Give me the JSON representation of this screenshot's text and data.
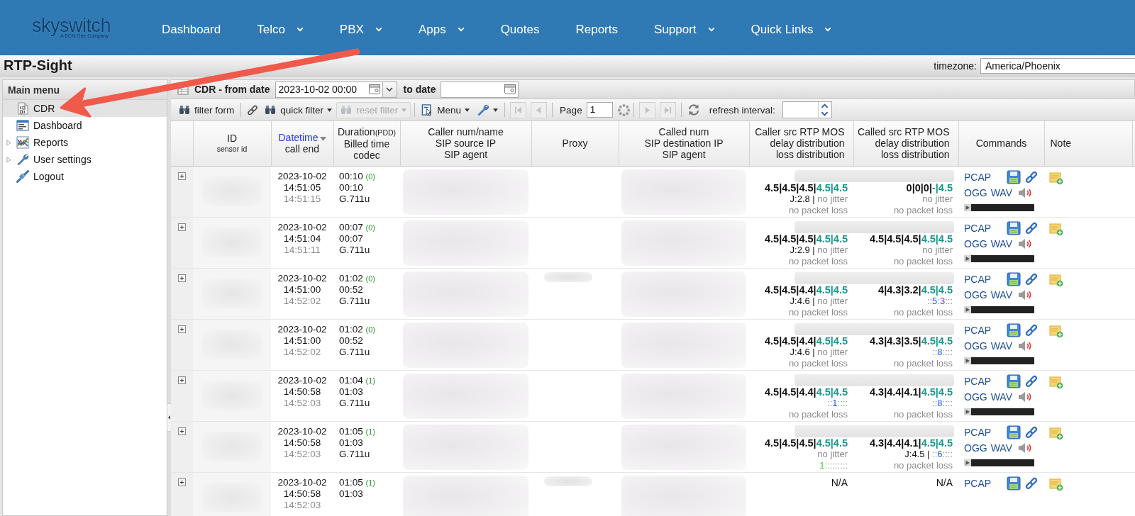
{
  "nav": {
    "logo": "skyswitch",
    "tagline": "A BCN One Company",
    "items": [
      {
        "label": "Dashboard",
        "dropdown": false
      },
      {
        "label": "Telco",
        "dropdown": true
      },
      {
        "label": "PBX",
        "dropdown": true
      },
      {
        "label": "Apps",
        "dropdown": true
      },
      {
        "label": "Quotes",
        "dropdown": false
      },
      {
        "label": "Reports",
        "dropdown": false
      },
      {
        "label": "Support",
        "dropdown": true
      },
      {
        "label": "Quick Links",
        "dropdown": true
      }
    ]
  },
  "title_bar": {
    "title": "RTP-Sight",
    "timezone_label": "timezone:",
    "timezone": "America/Phoenix"
  },
  "sidebar": {
    "title": "Main menu",
    "items": [
      {
        "label": "CDR",
        "kind": "leaf",
        "selected": true
      },
      {
        "label": "Dashboard",
        "kind": "leaf",
        "selected": false
      },
      {
        "label": "Reports",
        "kind": "folder",
        "expanded": false,
        "selected": false
      },
      {
        "label": "User settings",
        "kind": "folder",
        "expanded": false,
        "selected": false
      },
      {
        "label": "Logout",
        "kind": "leaf",
        "selected": false
      }
    ]
  },
  "filter_bar": {
    "title": "CDR - from date",
    "from_date": "2023-10-02 00:00",
    "to_label": "to date"
  },
  "toolbar": {
    "filter_form": "filter form",
    "quick_filter": {
      "label": "quick filter",
      "disabled": false
    },
    "reset_filter": {
      "label": "reset filter",
      "disabled": true
    },
    "menu": "Menu",
    "pager": [
      {
        "disabled": true
      },
      {
        "disabled": true
      },
      {
        "disabled": true
      },
      {
        "disabled": true
      }
    ],
    "page_label": "Page",
    "page": "1",
    "refresh_label": "refresh interval:"
  },
  "table": {
    "columns": [
      {
        "lines": [
          "ID"
        ],
        "sub": "sensor id",
        "sorted": false
      },
      {
        "lines": [
          "Datetime",
          "call end"
        ],
        "sorted": true
      },
      {
        "lines": [
          "Duration",
          "Billed time",
          "codec"
        ],
        "suffix": "(PDD)",
        "sorted": false
      },
      {
        "lines": [
          "Caller num/name",
          "SIP source IP",
          "SIP agent"
        ],
        "sorted": false
      },
      {
        "lines": [
          "Proxy"
        ],
        "sorted": false
      },
      {
        "lines": [
          "Called num",
          "SIP destination IP",
          "SIP agent"
        ],
        "sorted": false
      },
      {
        "lines": [
          "Caller src RTP MOS",
          "delay distribution",
          "loss distribution"
        ],
        "sorted": false
      },
      {
        "lines": [
          "Called src RTP MOS",
          "delay distribution",
          "loss distribution"
        ],
        "sorted": false
      },
      {
        "lines": [
          "Commands"
        ],
        "sorted": false
      },
      {
        "lines": [
          "Note"
        ],
        "sorted": false
      }
    ],
    "rows": [
      {
        "datetime": {
          "date": "2023-10-02",
          "start": "14:51:05",
          "end": "14:51:15"
        },
        "duration": {
          "total": "00:10",
          "pdd": "(0)",
          "billed": "00:10",
          "codec": "G.711u"
        },
        "proxy_redacted": false,
        "caller_rtp": {
          "mos": [
            {
              "text": "4.5|4.5|4.5|",
              "kind": "value"
            },
            {
              "text": "4.5|4.5",
              "kind": "estimate"
            }
          ],
          "jitter": [
            {
              "text": "J:2.8 | ",
              "kind": "value"
            },
            {
              "text": "no jitter",
              "kind": "muted"
            }
          ],
          "loss": [
            {
              "text": "no packet loss",
              "kind": "muted"
            }
          ]
        },
        "called_rtp": {
          "mos": [
            {
              "text": "0|0|0|",
              "kind": "value"
            },
            {
              "text": "-|4.5",
              "kind": "estimate"
            }
          ],
          "jitter": [
            {
              "text": "no jitter",
              "kind": "muted"
            }
          ],
          "loss": [
            {
              "text": "no packet loss",
              "kind": "muted"
            }
          ]
        },
        "commands": {
          "pcap": "PCAP",
          "ogg": "OGG",
          "wav": "WAV"
        }
      },
      {
        "datetime": {
          "date": "2023-10-02",
          "start": "14:51:04",
          "end": "14:51:11"
        },
        "duration": {
          "total": "00:07",
          "pdd": "(0)",
          "billed": "00:07",
          "codec": "G.711u"
        },
        "proxy_redacted": false,
        "caller_rtp": {
          "mos": [
            {
              "text": "4.5|4.5|4.5|",
              "kind": "value"
            },
            {
              "text": "4.5|4.5",
              "kind": "estimate"
            }
          ],
          "jitter": [
            {
              "text": "J:2.9 | ",
              "kind": "value"
            },
            {
              "text": "no jitter",
              "kind": "muted"
            }
          ],
          "loss": [
            {
              "text": "no packet loss",
              "kind": "muted"
            }
          ]
        },
        "called_rtp": {
          "mos": [
            {
              "text": "4.5|4.5|4.5|",
              "kind": "value"
            },
            {
              "text": "4.5|4.5",
              "kind": "estimate"
            }
          ],
          "jitter": [
            {
              "text": "no jitter",
              "kind": "muted"
            }
          ],
          "loss": [
            {
              "text": "no packet loss",
              "kind": "muted"
            }
          ]
        },
        "commands": {
          "pcap": "PCAP",
          "ogg": "OGG",
          "wav": "WAV"
        }
      },
      {
        "datetime": {
          "date": "2023-10-02",
          "start": "14:51:00",
          "end": "14:52:02"
        },
        "duration": {
          "total": "01:02",
          "pdd": "(0)",
          "billed": "00:52",
          "codec": "G.711u"
        },
        "proxy_redacted": true,
        "caller_rtp": {
          "mos": [
            {
              "text": "4.5|4.5|4.4|",
              "kind": "value"
            },
            {
              "text": "4.5|4.5",
              "kind": "estimate"
            }
          ],
          "jitter": [
            {
              "text": "J:4.6 | ",
              "kind": "value"
            },
            {
              "text": "no jitter",
              "kind": "muted"
            }
          ],
          "loss": [
            {
              "text": "no packet loss",
              "kind": "muted"
            }
          ]
        },
        "called_rtp": {
          "mos": [
            {
              "text": "4|4.3|3.2|",
              "kind": "value"
            },
            {
              "text": "4.5|4.5",
              "kind": "estimate"
            }
          ],
          "jitter": [
            {
              "text": "::",
              "kind": "muted"
            },
            {
              "text": "5",
              "kind": "bucket"
            },
            {
              "text": ":",
              "kind": "muted"
            },
            {
              "text": "3",
              "kind": "peak"
            },
            {
              "text": ":::",
              "kind": "muted"
            }
          ],
          "loss": [
            {
              "text": "no packet loss",
              "kind": "muted"
            }
          ]
        },
        "commands": {
          "pcap": "PCAP",
          "ogg": "OGG",
          "wav": "WAV"
        }
      },
      {
        "datetime": {
          "date": "2023-10-02",
          "start": "14:51:00",
          "end": "14:52:02"
        },
        "duration": {
          "total": "01:02",
          "pdd": "(0)",
          "billed": "00:52",
          "codec": "G.711u"
        },
        "proxy_redacted": false,
        "caller_rtp": {
          "mos": [
            {
              "text": "4.5|4.5|4.4|",
              "kind": "value"
            },
            {
              "text": "4.5|4.5",
              "kind": "estimate"
            }
          ],
          "jitter": [
            {
              "text": "J:4.6 | ",
              "kind": "value"
            },
            {
              "text": "no jitter",
              "kind": "muted"
            }
          ],
          "loss": [
            {
              "text": "no packet loss",
              "kind": "muted"
            }
          ]
        },
        "called_rtp": {
          "mos": [
            {
              "text": "4.3|4.3|3.5|",
              "kind": "value"
            },
            {
              "text": "4.5|4.5",
              "kind": "estimate"
            }
          ],
          "jitter": [
            {
              "text": "::",
              "kind": "muted"
            },
            {
              "text": "8",
              "kind": "bucket"
            },
            {
              "text": "::::",
              "kind": "muted"
            }
          ],
          "loss": [
            {
              "text": "no packet loss",
              "kind": "muted"
            }
          ]
        },
        "commands": {
          "pcap": "PCAP",
          "ogg": "OGG",
          "wav": "WAV"
        }
      },
      {
        "datetime": {
          "date": "2023-10-02",
          "start": "14:50:58",
          "end": "14:52:03"
        },
        "duration": {
          "total": "01:04",
          "pdd": "(1)",
          "billed": "01:03",
          "codec": "G.711u"
        },
        "proxy_redacted": false,
        "caller_rtp": {
          "mos": [
            {
              "text": "4.5|4.5|4.4|",
              "kind": "value"
            },
            {
              "text": "4.5|4.5",
              "kind": "estimate"
            }
          ],
          "jitter": [
            {
              "text": "::",
              "kind": "muted"
            },
            {
              "text": "1",
              "kind": "bucket"
            },
            {
              "text": "::::",
              "kind": "muted"
            }
          ],
          "loss": [
            {
              "text": "no packet loss",
              "kind": "muted"
            }
          ]
        },
        "called_rtp": {
          "mos": [
            {
              "text": "4.3|4.4|4.1|",
              "kind": "value"
            },
            {
              "text": "4.5|4.5",
              "kind": "estimate"
            }
          ],
          "jitter": [
            {
              "text": "::",
              "kind": "muted"
            },
            {
              "text": "8",
              "kind": "bucket"
            },
            {
              "text": "::::",
              "kind": "muted"
            }
          ],
          "loss": [
            {
              "text": "no packet loss",
              "kind": "muted"
            }
          ]
        },
        "commands": {
          "pcap": "PCAP",
          "ogg": "OGG",
          "wav": "WAV"
        }
      },
      {
        "datetime": {
          "date": "2023-10-02",
          "start": "14:50:58",
          "end": "14:52:03"
        },
        "duration": {
          "total": "01:05",
          "pdd": "(1)",
          "billed": "01:03",
          "codec": "G.711u"
        },
        "proxy_redacted": false,
        "caller_rtp": {
          "mos": [
            {
              "text": "4.5|4.5|4.5|",
              "kind": "value"
            },
            {
              "text": "4.5|4.5",
              "kind": "estimate"
            }
          ],
          "jitter": [
            {
              "text": "no jitter",
              "kind": "muted"
            }
          ],
          "loss": [
            {
              "text": "1",
              "kind": "loss"
            },
            {
              "text": ":::::::::",
              "kind": "muted"
            }
          ]
        },
        "called_rtp": {
          "mos": [
            {
              "text": "4.3|4.4|4.1|",
              "kind": "value"
            },
            {
              "text": "4.5|4.5",
              "kind": "estimate"
            }
          ],
          "jitter": [
            {
              "text": "J:4.5 | ",
              "kind": "value"
            },
            {
              "text": "::",
              "kind": "muted"
            },
            {
              "text": "6",
              "kind": "bucket"
            },
            {
              "text": "::::",
              "kind": "muted"
            }
          ],
          "loss": [
            {
              "text": "no packet loss",
              "kind": "muted"
            }
          ]
        },
        "commands": {
          "pcap": "PCAP",
          "ogg": "OGG",
          "wav": "WAV"
        }
      },
      {
        "datetime": {
          "date": "2023-10-02",
          "start": "14:50:58",
          "end": "14:52:03"
        },
        "duration": {
          "total": "01:05",
          "pdd": "(1)",
          "billed": "01:03"
        },
        "proxy_redacted": true,
        "caller_rtp": {
          "na": "N/A"
        },
        "called_rtp": {
          "na": "N/A"
        },
        "commands": {
          "pcap": "PCAP"
        }
      }
    ]
  }
}
